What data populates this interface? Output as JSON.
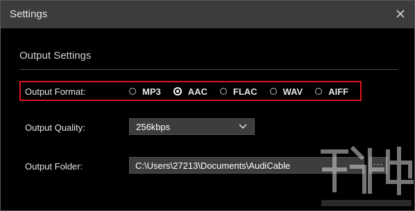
{
  "window": {
    "title": "Settings"
  },
  "section": {
    "title": "Output Settings"
  },
  "output_format": {
    "label": "Output Format:",
    "options": [
      "MP3",
      "AAC",
      "FLAC",
      "WAV",
      "AIFF"
    ],
    "selected": "AAC",
    "highlight_color": "#e0161f"
  },
  "output_quality": {
    "label": "Output Quality:",
    "value": "256kbps"
  },
  "output_folder": {
    "label": "Output Folder:",
    "value": "C:\\Users\\27213\\Documents\\AudiCable",
    "browse_label": "···"
  },
  "icons": {
    "close": "close-icon",
    "dropdown": "chevron-down-icon",
    "watermark": "watermark-logo"
  }
}
